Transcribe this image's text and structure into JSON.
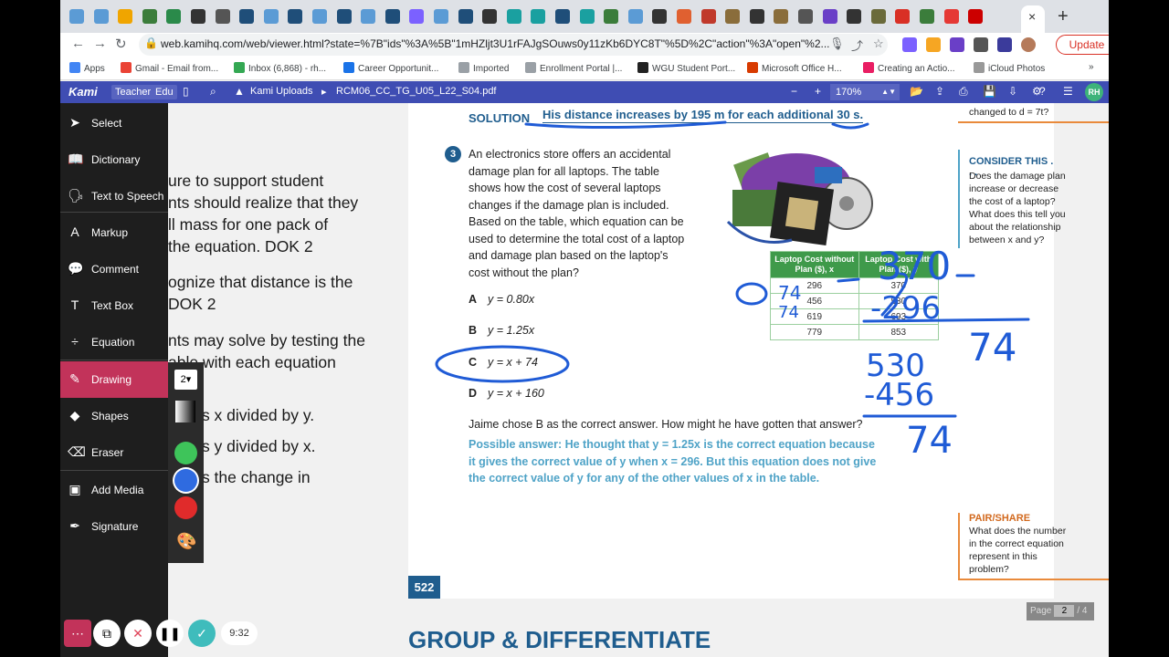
{
  "browser": {
    "tabs_count": 38,
    "active_tab_close": "×",
    "new_tab": "+",
    "url": "web.kamihq.com/web/viewer.html?state=%7B\"ids\"%3A%5B\"1mHZljt3U1rFAJgSOuws0y11zKb6DYC8T\"%5D%2C\"action\"%3A\"open\"%2...",
    "update_label": "Update",
    "back": "←",
    "forward": "→",
    "reload": "↻"
  },
  "bookmarks": [
    {
      "label": "Apps",
      "color": "#4285f4"
    },
    {
      "label": "Gmail - Email from...",
      "color": "#ea4335"
    },
    {
      "label": "Inbox (6,868) - rh...",
      "color": "#34a853"
    },
    {
      "label": "Career Opportunit...",
      "color": "#1a73e8"
    },
    {
      "label": "Imported",
      "color": "#9aa0a6"
    },
    {
      "label": "Enrollment Portal |...",
      "color": "#9aa0a6"
    },
    {
      "label": "WGU Student Port...",
      "color": "#222222"
    },
    {
      "label": "Microsoft Office H...",
      "color": "#d83b01"
    },
    {
      "label": "Creating an Actio...",
      "color": "#e91e63"
    },
    {
      "label": "iCloud Photos",
      "color": "#999999"
    }
  ],
  "bookmarks_more": "»",
  "kami": {
    "logo": "Kami",
    "role": "Teacher",
    "edu": "Edu",
    "breadcrumb_folder": "Kami Uploads",
    "breadcrumb_sep": "▸",
    "filename": "RCM06_CC_TG_U05_L22_S04.pdf",
    "zoom_minus": "−",
    "zoom_plus": "+",
    "zoom": "170%",
    "user_initials": "RH"
  },
  "sidebar": {
    "items": [
      {
        "label": "Select",
        "icon": "cursor-icon",
        "glyph": "➤"
      },
      {
        "label": "Dictionary",
        "icon": "book-icon",
        "glyph": "📖"
      },
      {
        "label": "Text to Speech",
        "icon": "speech-icon",
        "glyph": "🗣"
      },
      {
        "label": "Markup",
        "icon": "markup-icon",
        "glyph": "A"
      },
      {
        "label": "Comment",
        "icon": "comment-icon",
        "glyph": "💬"
      },
      {
        "label": "Text Box",
        "icon": "textbox-icon",
        "glyph": "T"
      },
      {
        "label": "Equation",
        "icon": "equation-icon",
        "glyph": "÷"
      },
      {
        "label": "Drawing",
        "icon": "pen-icon",
        "glyph": "✎"
      },
      {
        "label": "Shapes",
        "icon": "shapes-icon",
        "glyph": "◆"
      },
      {
        "label": "Eraser",
        "icon": "eraser-icon",
        "glyph": "⌫"
      },
      {
        "label": "Add Media",
        "icon": "media-icon",
        "glyph": "▣"
      },
      {
        "label": "Signature",
        "icon": "signature-icon",
        "glyph": "✒"
      }
    ],
    "active_index": 7
  },
  "drawing": {
    "size": "2▾",
    "colors": [
      "#3ec45a",
      "#2f6be0",
      "#e02b2b"
    ],
    "selected_color": "#2f6be0"
  },
  "recorder": {
    "timer": "9:32"
  },
  "left_fragment": [
    {
      "text": "ure to support student",
      "bold": "ure"
    },
    {
      "text": "nts should realize that they"
    },
    {
      "text": "ll mass for one pack of"
    },
    {
      "text": "the equation. DOK 2"
    },
    {
      "text": "ognize that distance is the"
    },
    {
      "text": "DOK 2"
    },
    {
      "text": "nts may solve by testing the"
    },
    {
      "text": "able with each equation"
    },
    {
      "text": "wer is x divided by y."
    },
    {
      "text": "wer is y divided by x."
    },
    {
      "text": "wer is the change in"
    }
  ],
  "page": {
    "solution_label": "SOLUTION",
    "solution_text": "His distance increases by 195 m for each additional 30 s.",
    "question_number": "3",
    "question_text": "An electronics store offers an accidental damage plan for all laptops. The table shows how the cost of several laptops changes if the damage plan is included. Based on the table, which equation can be used to determine the total cost of a laptop and damage plan based on the laptop's cost without the plan?",
    "choices": [
      {
        "letter": "A",
        "eq": "y = 0.80x"
      },
      {
        "letter": "B",
        "eq": "y = 1.25x"
      },
      {
        "letter": "C",
        "eq": "y = x + 74"
      },
      {
        "letter": "D",
        "eq": "y = x + 160"
      }
    ],
    "followup": "Jaime chose B as the correct answer. How might he have gotten that answer?",
    "answer": "Possible answer: He thought that y = 1.25x is the correct equation because it gives the correct value of y when x = 296. But this equation does not give the correct value of y for any of the other values of x in the table.",
    "table": {
      "headers": [
        "Laptop Cost without Plan ($), x",
        "Laptop Cost with Plan ($), y"
      ],
      "rows": [
        [
          "296",
          "370"
        ],
        [
          "456",
          "530"
        ],
        [
          "619",
          "693"
        ],
        [
          "779",
          "853"
        ]
      ]
    },
    "prev_text": "changed to d = 7t?",
    "consider_title": "CONSIDER THIS . . .",
    "consider_text": "Does the damage plan increase or decrease the cost of a laptop? What does this tell you about the relationship between x and y?",
    "pair_title": "PAIR/SHARE",
    "pair_text": "What does the number in the correct equation represent in this problem?",
    "page_number": "522"
  },
  "group_heading": "GROUP & DIFFERENTIATE",
  "pager": {
    "label": "Page",
    "current": "2",
    "total": "/ 4"
  },
  "handwriting": {
    "top_number": "370",
    "minus_row1": "-296",
    "result1": "74",
    "second_number": "530",
    "minus_row2": "-456",
    "result2": "74",
    "table_note": "74",
    "table_note2": "74"
  }
}
